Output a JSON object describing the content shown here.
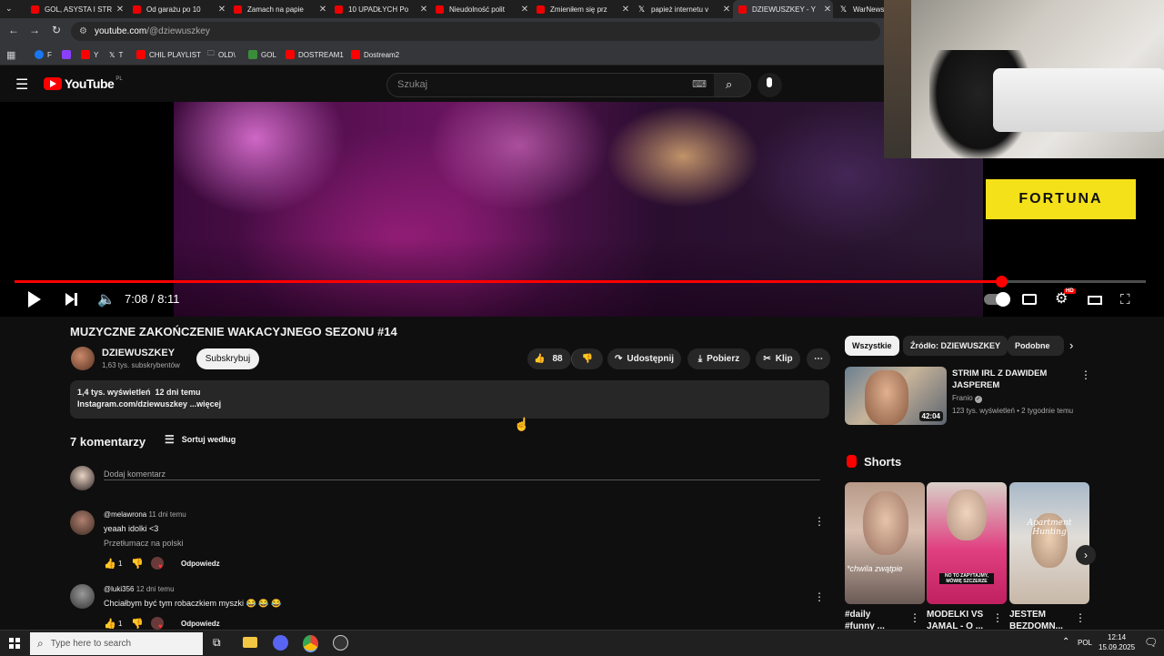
{
  "browser": {
    "tabs": [
      {
        "title": "GOL, ASYSTA I STR",
        "icon": "youtube-icon",
        "active": false
      },
      {
        "title": "Od garażu po 10",
        "icon": "youtube-icon",
        "active": false
      },
      {
        "title": "Zamach na papie",
        "icon": "youtube-icon",
        "active": false
      },
      {
        "title": "10 UPADŁYCH Po",
        "icon": "youtube-icon",
        "active": false
      },
      {
        "title": "Nieudolność polit",
        "icon": "youtube-icon",
        "active": false
      },
      {
        "title": "Zmieniłem się prz",
        "icon": "youtube-icon",
        "active": false
      },
      {
        "title": "papież internetu v",
        "icon": "x-icon",
        "active": false
      },
      {
        "title": "DZIEWUSZKEY - Y",
        "icon": "youtube-icon",
        "active": true
      },
      {
        "title": "WarNews",
        "icon": "x-icon",
        "active": false
      }
    ],
    "url_host": "youtube.com",
    "url_path": "/@dziewuszkey",
    "bookmarks": [
      {
        "label": "F",
        "color": "#1877f2"
      },
      {
        "label": "",
        "color": "#8a3ffc"
      },
      {
        "label": "Y",
        "color": "#ff0000"
      },
      {
        "label": "T",
        "color": "#111111"
      },
      {
        "label": "CHIL PLAYLIST",
        "color": "#ff0000"
      },
      {
        "label": "OLD\\",
        "color": ""
      },
      {
        "label": "GOL",
        "color": "#3a8e3a"
      },
      {
        "label": "DOSTREAM1",
        "color": "#ff0000"
      },
      {
        "label": "Dostream2",
        "color": "#ff0000"
      }
    ]
  },
  "youtube": {
    "logo_text": "YouTube",
    "logo_region": "PL",
    "search_placeholder": "Szukaj"
  },
  "player": {
    "time_current": "7:08",
    "time_total": "8:11",
    "time_separator": "/",
    "progress_fraction": 0.872,
    "buffered_fraction": 0.92,
    "sponsor_text": "FORTUNA"
  },
  "video": {
    "title": "MUZYCZNE ZAKOŃCZENIE WAKACYJNEGO SEZONU #14",
    "channel_name": "DZIEWUSZKEY",
    "subscribers": "1,63 tys. subskrybentów",
    "subscribe_label": "Subskrybuj",
    "likes": "88",
    "share_label": "Udostępnij",
    "download_label": "Pobierz",
    "clip_label": "Klip",
    "description_stats": "1,4 tys. wyświetleń  12 dni temu",
    "description_line": "Instagram.com/dziewuszkey",
    "description_more": "...więcej"
  },
  "comments": {
    "count_label": "7 komentarzy",
    "sort_label": "Sortuj według",
    "add_placeholder": "Dodaj komentarz",
    "items": [
      {
        "author": "@melawrona",
        "time": "11 dni temu",
        "text": "yeaah idolki <3",
        "translate": "Przetłumacz na polski",
        "likes": "1",
        "reply": "Odpowiedz"
      },
      {
        "author": "@luki356",
        "time": "12 dni temu",
        "text": "Chciałbym być tym robaczkiem myszki 😂 😂 😂",
        "translate": "",
        "likes": "1",
        "reply": "Odpowiedz"
      }
    ]
  },
  "sidebar": {
    "chips": [
      {
        "label": "Wszystkie",
        "selected": true
      },
      {
        "label": "Źródło: DZIEWUSZKEY",
        "selected": false
      },
      {
        "label": "Podobne",
        "selected": false
      }
    ],
    "recommended": {
      "title_line1": "STRIM IRL Z DAWIDEM",
      "title_line2": "JASPEREM",
      "channel": "Franio",
      "stats": "123 tys. wyświetleń • 2 tygodnie temu",
      "duration": "42:04"
    },
    "shorts_heading": "Shorts",
    "shorts": [
      {
        "title1": "#daily",
        "title2": "#funny ...",
        "overlay": "*chwila zwątpie"
      },
      {
        "title1": "MODELKI VS",
        "title2": "JAMAL - O ...",
        "overlay": "NO TO ZAPYTAJMY, MÓWIĘ SZCZERZE"
      },
      {
        "title1": "JESTEM",
        "title2": "BEZDOMN...",
        "overlay": "Apartment Hunting"
      }
    ]
  },
  "taskbar": {
    "search_placeholder": "Type here to search",
    "lang": "POL",
    "time": "12:14",
    "date": "15.09.2025"
  }
}
